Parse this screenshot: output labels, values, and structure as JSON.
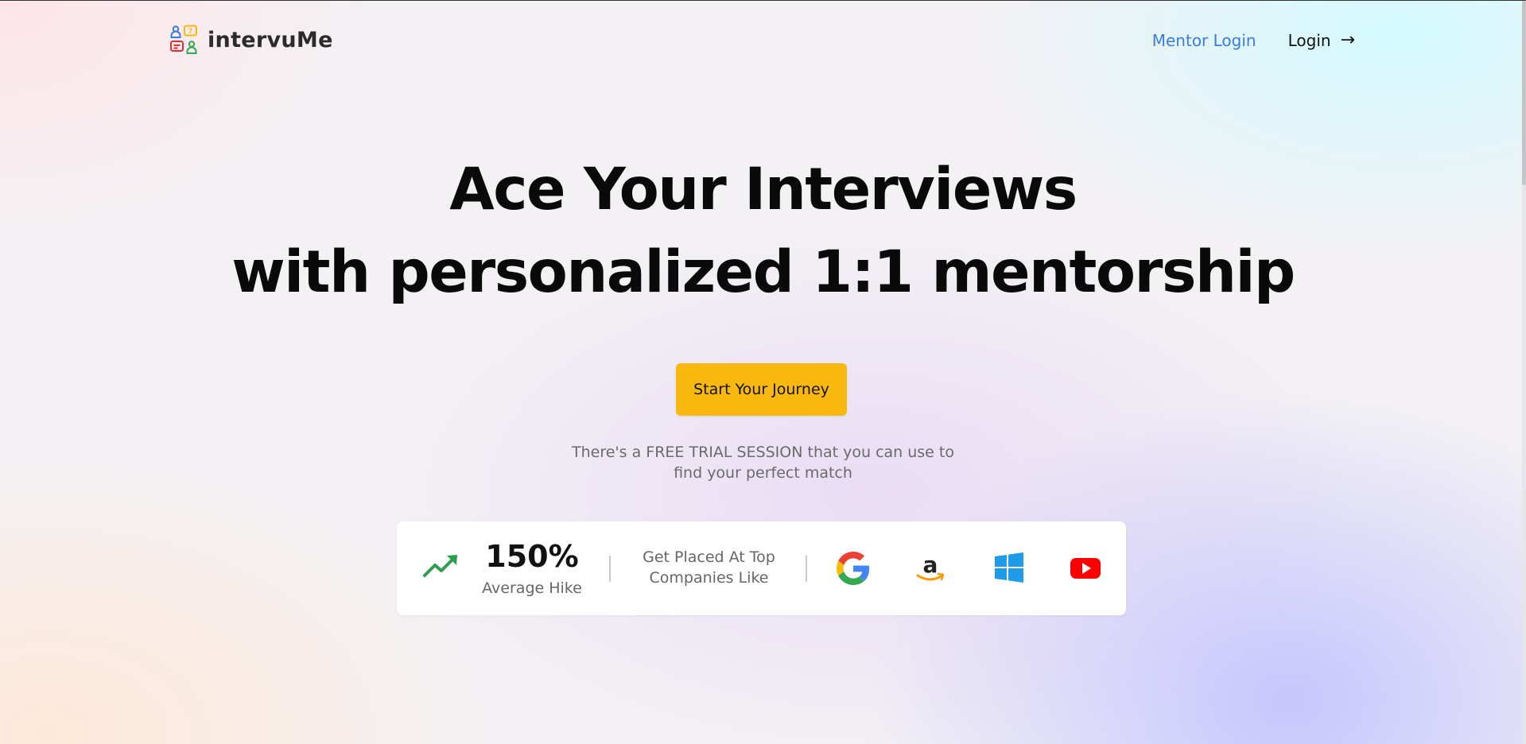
{
  "brand": {
    "name": "intervuMe",
    "logo_icon": "people-chat-logo-icon",
    "logo_colors": [
      "#3b7be0",
      "#f9b80e",
      "#e0302e",
      "#34a853"
    ]
  },
  "nav": {
    "mentor_login": "Mentor Login",
    "login": "Login",
    "login_arrow": "→",
    "mentor_color": "#3b7be0"
  },
  "hero": {
    "headline_line1": "Ace Your Interviews",
    "headline_line2": "with personalized 1:1 mentorship",
    "cta_label": "Start Your Journey",
    "cta_color": "#f9b80e",
    "trial_line1": "There's a FREE TRIAL SESSION that you can use to",
    "trial_line2": "find your perfect match"
  },
  "stats": {
    "trend_icon": "trending-up-icon",
    "value": "150%",
    "label": "Average Hike",
    "placed_line1": "Get Placed At Top",
    "placed_line2": "Companies Like",
    "companies": [
      {
        "name": "Google",
        "icon": "google-icon"
      },
      {
        "name": "Amazon",
        "icon": "amazon-icon"
      },
      {
        "name": "Microsoft",
        "icon": "windows-icon"
      },
      {
        "name": "YouTube",
        "icon": "youtube-icon"
      }
    ]
  }
}
